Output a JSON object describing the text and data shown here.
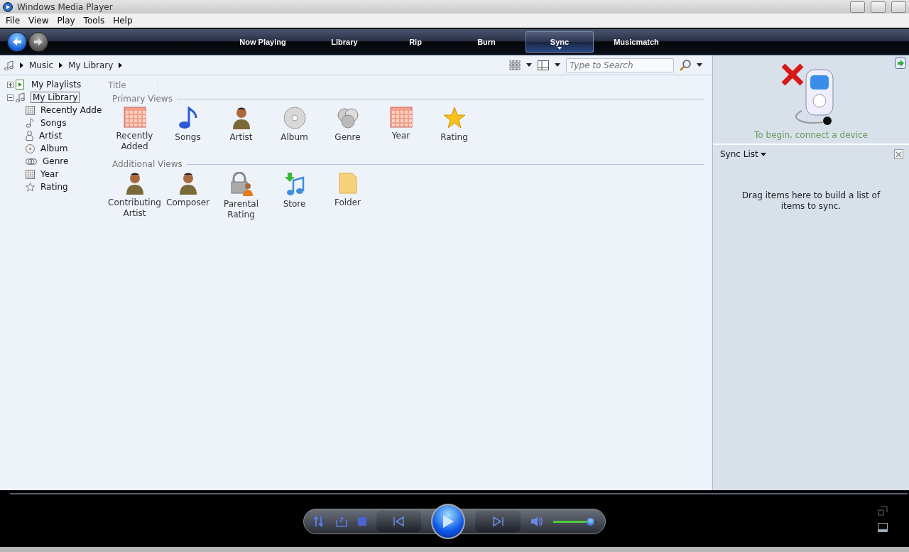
{
  "window": {
    "title": "Windows Media Player"
  },
  "menu": [
    "File",
    "View",
    "Play",
    "Tools",
    "Help"
  ],
  "tabs": [
    {
      "label": "Now Playing",
      "selected": false
    },
    {
      "label": "Library",
      "selected": false
    },
    {
      "label": "Rip",
      "selected": false
    },
    {
      "label": "Burn",
      "selected": false
    },
    {
      "label": "Sync",
      "selected": true
    },
    {
      "label": "Musicmatch",
      "selected": false
    }
  ],
  "breadcrumb": [
    "Music",
    "My Library"
  ],
  "search": {
    "placeholder": "Type to Search"
  },
  "tree": [
    {
      "label": "My Playlists",
      "kind": "playlist",
      "expanded": false,
      "selected": false
    },
    {
      "label": "My Library",
      "kind": "library",
      "expanded": true,
      "selected": true,
      "children": [
        {
          "label": "Recently Adde",
          "kind": "calendar"
        },
        {
          "label": "Songs",
          "kind": "note"
        },
        {
          "label": "Artist",
          "kind": "person"
        },
        {
          "label": "Album",
          "kind": "disc"
        },
        {
          "label": "Genre",
          "kind": "discs"
        },
        {
          "label": "Year",
          "kind": "calendar"
        },
        {
          "label": "Rating",
          "kind": "star"
        }
      ]
    }
  ],
  "column_header": "Title",
  "sections": [
    {
      "title": "Primary Views",
      "items": [
        {
          "label": "Recently Added",
          "kind": "calendar"
        },
        {
          "label": "Songs",
          "kind": "note"
        },
        {
          "label": "Artist",
          "kind": "person"
        },
        {
          "label": "Album",
          "kind": "disc"
        },
        {
          "label": "Genre",
          "kind": "discs"
        },
        {
          "label": "Year",
          "kind": "calendar"
        },
        {
          "label": "Rating",
          "kind": "star"
        }
      ]
    },
    {
      "title": "Additional Views",
      "items": [
        {
          "label": "Contributing Artist",
          "kind": "person"
        },
        {
          "label": "Composer",
          "kind": "person"
        },
        {
          "label": "Parental Rating",
          "kind": "lock"
        },
        {
          "label": "Store",
          "kind": "store"
        },
        {
          "label": "Folder",
          "kind": "folder"
        }
      ]
    }
  ],
  "device": {
    "message": "To begin, connect a device"
  },
  "sync_list": {
    "title": "Sync List",
    "hint": "Drag items here to build a list of items to sync."
  },
  "player": {
    "volume": {
      "level": 0.85
    }
  }
}
